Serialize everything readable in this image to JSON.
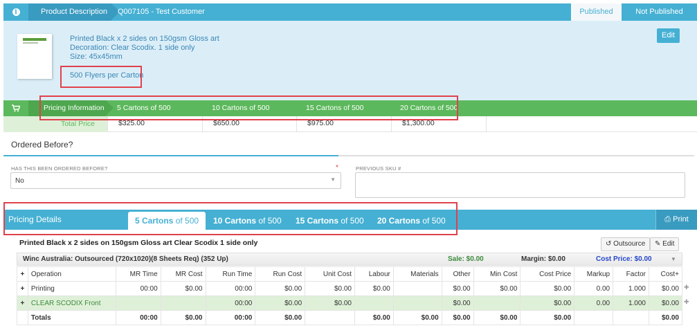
{
  "header": {
    "crumb": "Product Description",
    "quote": "Q007105 - Test Customer",
    "published": "Published",
    "not_published": "Not Published"
  },
  "product": {
    "line1": "Printed Black x 2 sides on 150gsm Gloss art",
    "line2": "Decoration: Clear Scodix. 1 side only",
    "line3": "Size: 45x45mm",
    "flyers": "500 Flyers per Carton",
    "edit": "Edit"
  },
  "pricing_info": {
    "label": "Pricing Information",
    "columns": [
      "5 Cartons of 500",
      "10 Cartons of 500",
      "15 Cartons of 500",
      "20 Cartons of 500"
    ],
    "total_label": "Total Price",
    "totals": [
      "$325.00",
      "$650.00",
      "$975.00",
      "$1,300.00"
    ]
  },
  "ordered_before": {
    "title": "Ordered Before?",
    "question_label": "HAS THIS BEEN ORDERED BEFORE?",
    "required_mark": "*",
    "value": "No",
    "sku_label": "PREVIOUS SKU #"
  },
  "pricing_details": {
    "title": "Pricing Details",
    "tabs": [
      {
        "bold": "5 Cartons",
        "rest": " of 500"
      },
      {
        "bold": "10 Cartons",
        "rest": " of 500"
      },
      {
        "bold": "15 Cartons",
        "rest": " of 500"
      },
      {
        "bold": "20 Cartons",
        "rest": " of 500"
      }
    ],
    "print": "Print",
    "heading": "Printed Black x 2 sides on 150gsm Gloss art Clear Scodix 1 side only",
    "outsource": "Outsource",
    "edit": "Edit"
  },
  "supplier": {
    "name": "Winc Australia: Outsourced (720x1020)(8 Sheets Req) (352 Up)",
    "sale": "Sale: $0.00",
    "margin": "Margin: $0.00",
    "cost_price": "Cost Price: $0.00"
  },
  "ops_table": {
    "headers": [
      "Operation",
      "MR Time",
      "MR Cost",
      "Run Time",
      "Run Cost",
      "Unit Cost",
      "Labour",
      "Materials",
      "Other",
      "Min Cost",
      "Cost Price",
      "Markup",
      "Factor",
      "Cost+"
    ],
    "rows": [
      {
        "name": "Printing",
        "mr_time": "00:00",
        "mr_cost": "$0.00",
        "run_time": "00:00",
        "run_cost": "$0.00",
        "unit_cost": "$0.00",
        "labour": "$0.00",
        "materials": "",
        "other": "$0.00",
        "min_cost": "$0.00",
        "cost_price": "$0.00",
        "markup": "0.00",
        "factor": "1.000",
        "cost_plus": "$0.00"
      },
      {
        "name": "CLEAR SCODIX Front",
        "mr_time": "",
        "mr_cost": "",
        "run_time": "00:00",
        "run_cost": "$0.00",
        "unit_cost": "$0.00",
        "labour": "",
        "materials": "",
        "other": "$0.00",
        "min_cost": "",
        "cost_price": "$0.00",
        "markup": "0.00",
        "factor": "1.000",
        "cost_plus": "$0.00"
      }
    ],
    "totals": {
      "label": "Totals",
      "mr_time": "00:00",
      "mr_cost": "$0.00",
      "run_time": "00:00",
      "run_cost": "$0.00",
      "unit_cost": "",
      "labour": "$0.00",
      "materials": "$0.00",
      "other": "$0.00",
      "min_cost": "$0.00",
      "cost_price": "$0.00",
      "markup": "",
      "factor": "",
      "cost_plus": "$0.00"
    }
  },
  "colors": {
    "blue": "#45b0d3",
    "green": "#5cb85c",
    "highlight_red": "#e0414a"
  }
}
